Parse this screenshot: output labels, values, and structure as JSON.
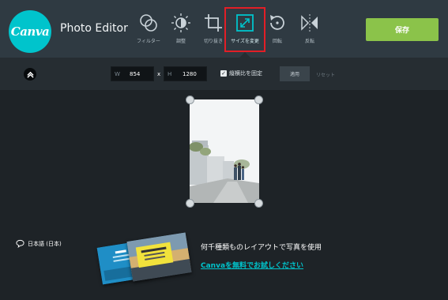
{
  "header": {
    "logo_text": "Canva",
    "app_title": "Photo Editor",
    "save_label": "保存"
  },
  "toolbar": {
    "tools": [
      {
        "label": "フィルター",
        "icon": "filter-icon"
      },
      {
        "label": "調整",
        "icon": "adjust-sun-icon"
      },
      {
        "label": "切り抜き",
        "icon": "crop-icon"
      },
      {
        "label": "サイズを変更",
        "icon": "resize-icon",
        "active": true
      },
      {
        "label": "回転",
        "icon": "rotate-icon"
      },
      {
        "label": "反転",
        "icon": "flip-icon"
      }
    ]
  },
  "resize": {
    "width_prefix": "W",
    "width_value": "854",
    "separator": "x",
    "height_prefix": "H",
    "height_value": "1280",
    "lock_checked": true,
    "lock_label": "縦横比を固定",
    "apply_label": "適用",
    "reset_label": "リセット"
  },
  "footer": {
    "language": "日本語 (日本)",
    "promo_text": "何千種類ものレイアウトで写真を使用",
    "promo_link": "Canvaを無料でお試しください"
  },
  "colors": {
    "accent": "#00c4cc",
    "save_button": "#8bc34a",
    "highlight_box": "#e21e26",
    "topbar": "#2f3a42",
    "canvas": "#1e2327"
  }
}
